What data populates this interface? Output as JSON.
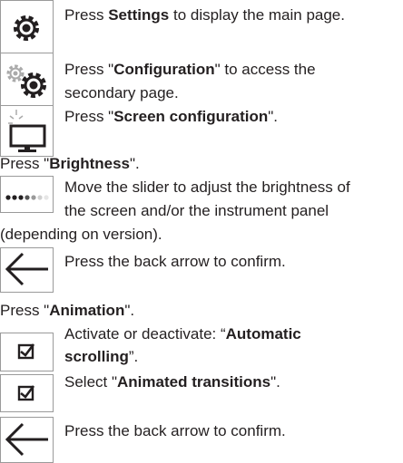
{
  "steps": [
    {
      "pre": "Press ",
      "bold": "Settings",
      "post": " to display the main page."
    },
    {
      "pre": "Press \"",
      "bold": "Configuration",
      "post": "\" to access the"
    },
    {
      "text": "secondary page."
    },
    {
      "pre": "Press \"",
      "bold": "Screen configuration",
      "post": "\"."
    },
    {
      "pre": "Press \"",
      "bold": "Brightness",
      "post": "\"."
    },
    {
      "text": "Move the slider to adjust the brightness of"
    },
    {
      "text": "the screen and/or the instrument panel"
    },
    {
      "text": "(depending on version)."
    },
    {
      "text": "Press the back arrow to confirm."
    },
    {
      "pre": "Press \"",
      "bold": "Animation",
      "post": "\"."
    },
    {
      "pre": "Activate or deactivate: “",
      "bold": "Automatic",
      "post": ""
    },
    {
      "pre": "",
      "bold": "scrolling",
      "post": "”."
    },
    {
      "pre": "Select \"",
      "bold": "Animated transitions",
      "post": "\"."
    },
    {
      "text": "Press the back arrow to confirm."
    }
  ],
  "icons": [
    "gear-icon",
    "gears-icon",
    "screen-brightness-icon",
    "slider-dots-icon",
    "back-arrow-icon",
    "checkbox-icon",
    "checkbox-icon",
    "back-arrow-icon"
  ]
}
